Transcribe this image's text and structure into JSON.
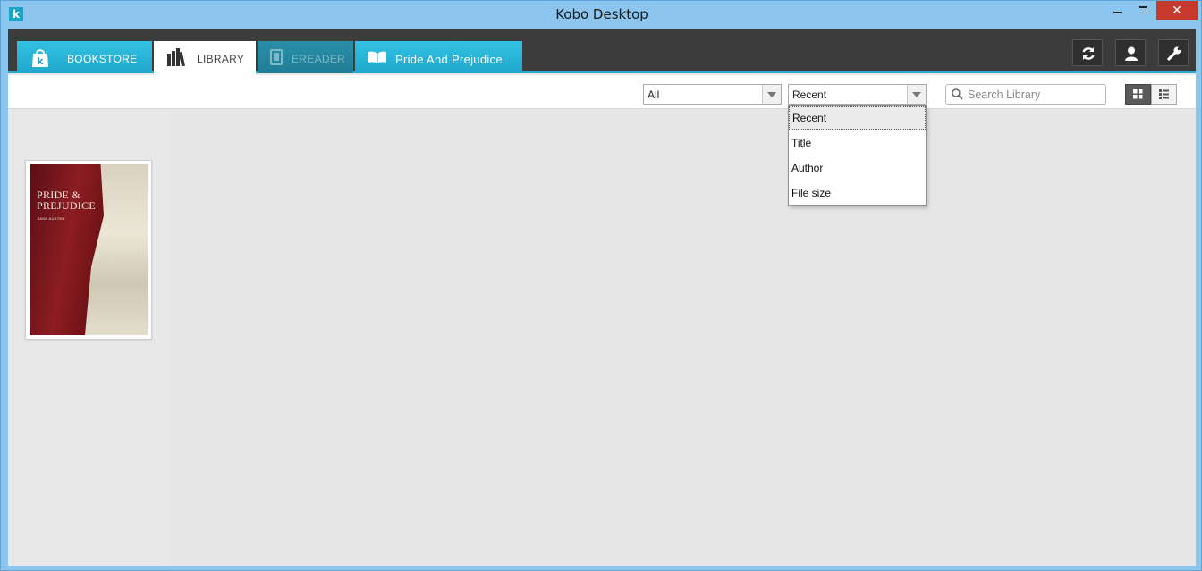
{
  "window": {
    "title": "Kobo Desktop",
    "app_icon_letter": "k",
    "close_glyph": "✕"
  },
  "tabs": [
    {
      "label": "BOOKSTORE",
      "icon": "shopping-bag-icon"
    },
    {
      "label": "LIBRARY",
      "icon": "books-icon",
      "active": true
    },
    {
      "label": "EREADER",
      "icon": "ereader-icon",
      "disabled": true
    },
    {
      "label": "Pride And Prejudice",
      "icon": "open-book-icon"
    }
  ],
  "header_buttons": [
    {
      "name": "sync",
      "icon": "sync-icon"
    },
    {
      "name": "account",
      "icon": "user-icon"
    },
    {
      "name": "settings",
      "icon": "wrench-icon"
    }
  ],
  "toolbar": {
    "filter_value": "All",
    "sort_value": "Recent",
    "search_placeholder": "Search Library",
    "view_modes": [
      "grid",
      "list"
    ],
    "active_view": "grid"
  },
  "sort_options": [
    "Recent",
    "Title",
    "Author",
    "File size"
  ],
  "books": [
    {
      "cover_title_line1": "PRIDE &",
      "cover_title_line2": "PREJUDICE",
      "cover_author": "JANE AUSTEN"
    }
  ],
  "colors": {
    "accent": "#2aa9cf",
    "header_bg": "#3c3c3c",
    "content_bg": "#e6e6e6",
    "close_red": "#c7392b"
  }
}
